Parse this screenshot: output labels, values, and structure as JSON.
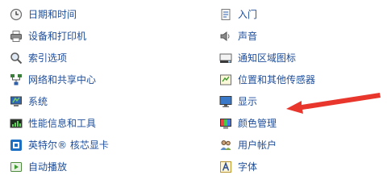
{
  "left_items": [
    {
      "label": "日期和时间",
      "icon": "clock-icon"
    },
    {
      "label": "设备和打印机",
      "icon": "printer-icon"
    },
    {
      "label": "索引选项",
      "icon": "search-index-icon"
    },
    {
      "label": "网络和共享中心",
      "icon": "network-icon"
    },
    {
      "label": "系统",
      "icon": "system-icon"
    },
    {
      "label": "性能信息和工具",
      "icon": "performance-icon"
    },
    {
      "label": "英特尔® 核芯显卡",
      "icon": "intel-graphics-icon"
    },
    {
      "label": "自动播放",
      "icon": "autoplay-icon"
    }
  ],
  "right_items": [
    {
      "label": "入门",
      "icon": "getting-started-icon"
    },
    {
      "label": "声音",
      "icon": "speaker-icon"
    },
    {
      "label": "通知区域图标",
      "icon": "notification-area-icon"
    },
    {
      "label": "位置和其他传感器",
      "icon": "location-sensor-icon"
    },
    {
      "label": "显示",
      "icon": "display-icon"
    },
    {
      "label": "颜色管理",
      "icon": "color-management-icon"
    },
    {
      "label": "用户帐户",
      "icon": "user-accounts-icon"
    },
    {
      "label": "字体",
      "icon": "fonts-icon"
    }
  ],
  "colors": {
    "link": "#1e4e9b",
    "annotation_arrow": "#e8362c"
  }
}
